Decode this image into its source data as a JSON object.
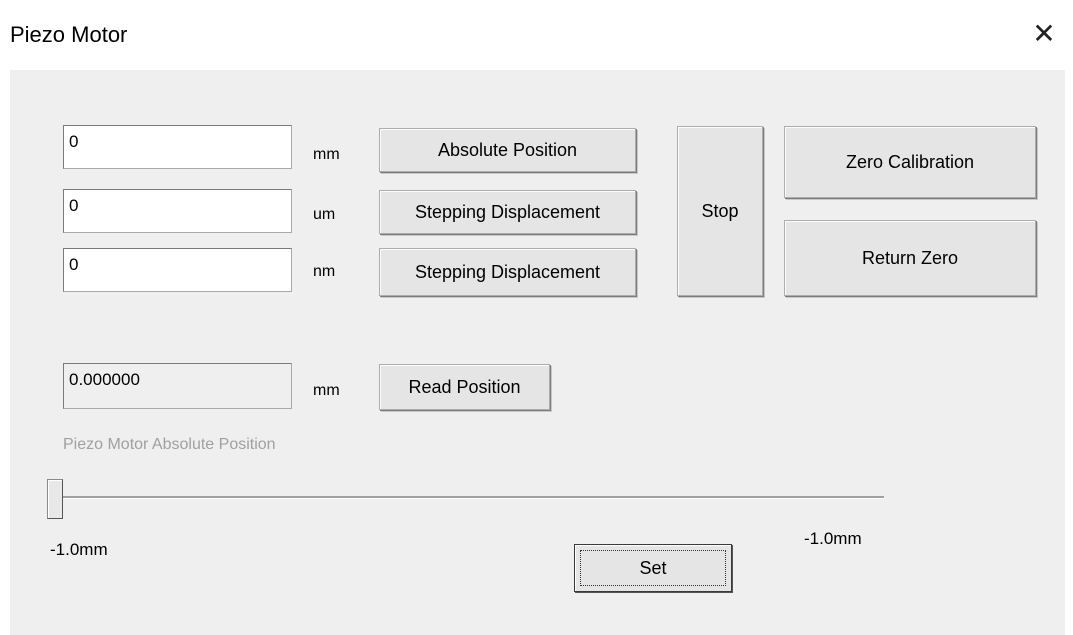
{
  "window": {
    "title": "Piezo Motor"
  },
  "inputs": [
    {
      "value": "0",
      "unit": "mm",
      "button": "Absolute Position"
    },
    {
      "value": "0",
      "unit": "um",
      "button": "Stepping Displacement"
    },
    {
      "value": "0",
      "unit": "nm",
      "button": "Stepping Displacement"
    }
  ],
  "actions": {
    "stop": "Stop",
    "zero_calibration": "Zero Calibration",
    "return_zero": "Return Zero"
  },
  "read": {
    "value": "0.000000",
    "unit": "mm",
    "button": "Read Position"
  },
  "slider": {
    "caption": "Piezo Motor Absolute Position",
    "min_label": "-1.0mm",
    "max_label": "-1.0mm",
    "position_fraction": 0.0
  },
  "set_button": "Set",
  "icons": {
    "close": "close-icon"
  }
}
